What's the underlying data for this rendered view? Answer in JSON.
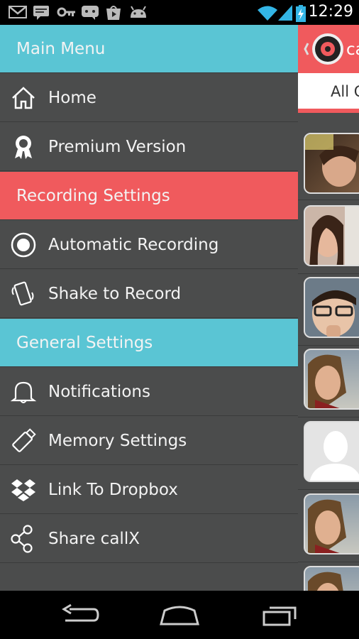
{
  "status_bar": {
    "time": "12:29",
    "icons": [
      "gmail-icon",
      "chat-icon",
      "key-icon",
      "messenger-icon",
      "play-store-icon",
      "android-icon",
      "wifi-icon",
      "signal-icon",
      "battery-charging-icon"
    ]
  },
  "drawer": {
    "main_menu_label": "Main Menu",
    "home_label": "Home",
    "premium_label": "Premium Version",
    "recording_settings_label": "Recording Settings",
    "automatic_recording_label": "Automatic Recording",
    "shake_label": "Shake to Record",
    "general_settings_label": "General Settings",
    "notifications_label": "Notifications",
    "memory_label": "Memory Settings",
    "dropbox_label": "Link To Dropbox",
    "share_label": "Share callX"
  },
  "peek": {
    "app_title_fragment": "ca",
    "tab_fragment": "All C"
  },
  "colors": {
    "cyan": "#5ac5d4",
    "red": "#f05a5d",
    "drawer_bg": "#4b4c4c"
  },
  "nav": {
    "icons": [
      "back-icon",
      "home-icon",
      "recent-apps-icon"
    ]
  }
}
